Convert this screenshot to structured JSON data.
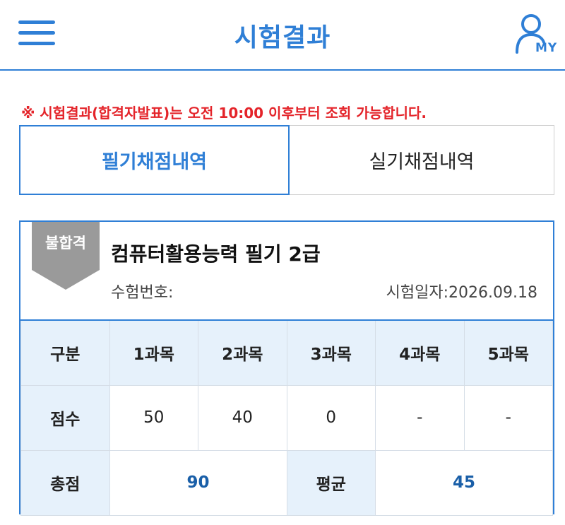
{
  "header": {
    "title": "시험결과",
    "my_label": "MY",
    "menu_icon": "hamburger-icon",
    "user_icon": "user-icon",
    "accent_color": "#2f7fd6"
  },
  "notice": "※ 시험결과(합격자발표)는 오전 10:00 이후부터 조회 가능합니다.",
  "tabs": [
    {
      "label": "필기채점내역",
      "active": true
    },
    {
      "label": "실기채점내역",
      "active": false
    }
  ],
  "result": {
    "status": "불합격",
    "exam_name": "컴퓨터활용능력 필기 2급",
    "exam_number_label": "수험번호:",
    "exam_date": "시험일자:2026.09.18",
    "table": {
      "header_label": "구분",
      "subjects": [
        "1과목",
        "2과목",
        "3과목",
        "4과목",
        "5과목"
      ],
      "score_label": "점수",
      "scores": [
        "50",
        "40",
        "0",
        "-",
        "-"
      ],
      "total_label": "총점",
      "total": "90",
      "average_label": "평균",
      "average": "45"
    }
  }
}
